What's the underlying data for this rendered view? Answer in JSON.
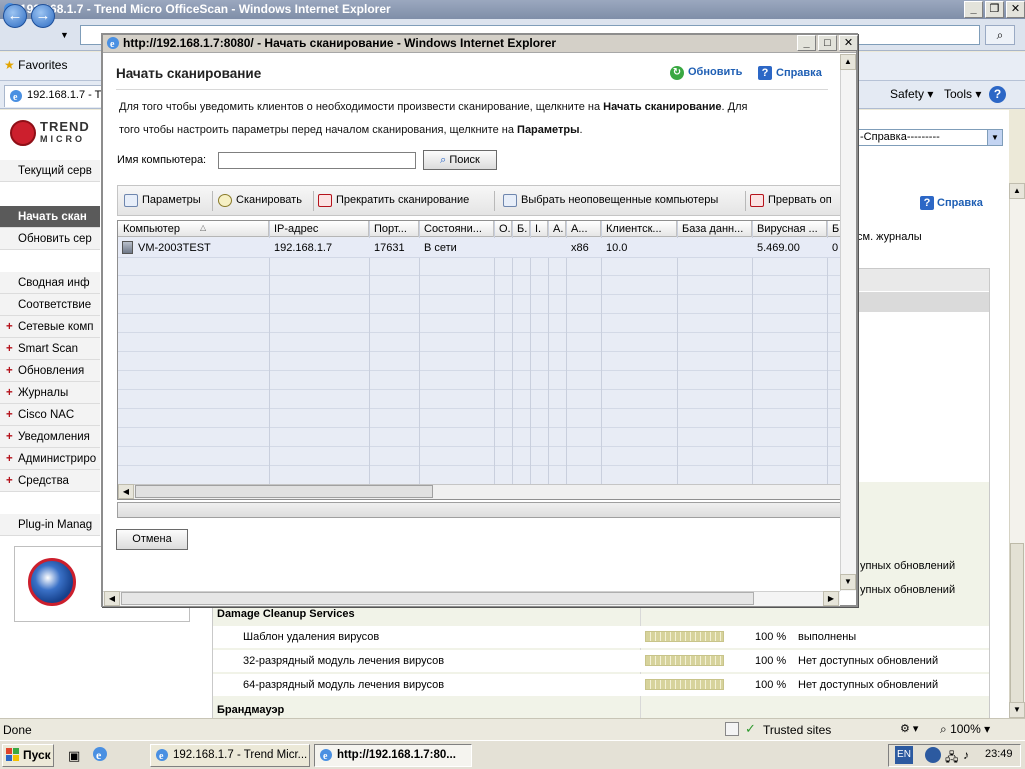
{
  "outer_window": {
    "title": "192.168.1.7 - Trend Micro OfficeScan - Windows Internet Explorer",
    "favorites_label": "Favorites",
    "tab_label": "192.168.1.7 - T",
    "safety_menu": "Safety ▾",
    "tools_menu": "Tools ▾",
    "help_menu": "?"
  },
  "background_page": {
    "logo_text_line1": "TREND",
    "logo_text_line2": "MICRO",
    "help_dropdown": "-Справка---------",
    "help_link": "Справка",
    "logs_text": "см. журналы",
    "left_nav": [
      {
        "label": "Текущий серв",
        "type": "plain"
      },
      {
        "label": "Начать скан",
        "type": "active"
      },
      {
        "label": "Обновить сер",
        "type": "plain"
      },
      {
        "label": "Сводная инф",
        "type": "plain"
      },
      {
        "label": "Соответствие",
        "type": "plain"
      },
      {
        "label": "Сетевые комп",
        "type": "plus"
      },
      {
        "label": "Smart Scan",
        "type": "plus"
      },
      {
        "label": "Обновления",
        "type": "plus"
      },
      {
        "label": "Журналы",
        "type": "plus"
      },
      {
        "label": "Cisco NAC",
        "type": "plus"
      },
      {
        "label": "Уведомления",
        "type": "plus"
      },
      {
        "label": "Администриро",
        "type": "plus"
      },
      {
        "label": "Средства",
        "type": "plus"
      },
      {
        "label": "Plug-in Manag",
        "type": "plain"
      }
    ],
    "partial_status_1": "упных обновлений",
    "partial_status_2": "упных обновлений",
    "section_damage": "Damage Cleanup Services",
    "damage_rows": [
      {
        "name": "Шаблон удаления вирусов",
        "progress": 100,
        "pct": "100 %",
        "status": "выполнены"
      },
      {
        "name": "32-разрядный модуль лечения вирусов",
        "progress": 100,
        "pct": "100 %",
        "status": "Нет доступных обновлений"
      },
      {
        "name": "64-разрядный модуль лечения вирусов",
        "progress": 100,
        "pct": "100 %",
        "status": "Нет доступных обновлений"
      }
    ],
    "section_firewall": "Брандмауэр"
  },
  "popup": {
    "title": "http://192.168.1.7:8080/ - Начать сканирование - Windows Internet Explorer",
    "heading": "Начать сканирование",
    "refresh_label": "Обновить",
    "help_label": "Справка",
    "desc_line1_pre": "Для того чтобы уведомить клиентов о необходимости произвести сканирование, щелкните на ",
    "desc_line1_bold": "Начать сканирование",
    "desc_line1_post": ". Для",
    "desc_line2_pre": "того чтобы настроить параметры перед началом сканирования, щелкните на ",
    "desc_line2_bold": "Параметры",
    "desc_line2_post": ".",
    "computer_name_label": "Имя компьютера:",
    "computer_name_value": "",
    "find_button": "Поиск",
    "toolbar": {
      "settings": "Параметры",
      "scan": "Сканировать",
      "stop_scan": "Прекратить сканирование",
      "select_unnotified": "Выбрать неоповещенные компьютеры",
      "abort": "Прервать оп"
    },
    "columns": [
      "Компьютер",
      "IP-адрес",
      "Порт...",
      "Состояни...",
      "О.",
      "Б.",
      "I.",
      "А.",
      "А...",
      "Клиентск...",
      "База данн...",
      "Вирусная ...",
      "Б"
    ],
    "rows": [
      {
        "computer": "VM-2003TEST",
        "ip": "192.168.1.7",
        "port": "17631",
        "state": "В сети",
        "c5": "",
        "c6": "",
        "c7": "",
        "c8": "",
        "arch": "x86",
        "client": "10.0",
        "db": "",
        "virus": "5.469.00",
        "last": "0"
      }
    ],
    "cancel_button": "Отмена"
  },
  "statusbar": {
    "left": "Done",
    "zone": "Trusted sites",
    "zoom": "100%"
  },
  "taskbar": {
    "start": "Пуск",
    "task1": "192.168.1.7 - Trend Micr...",
    "task2": "http://192.168.1.7:80...",
    "lang": "EN",
    "clock": "23:49"
  }
}
